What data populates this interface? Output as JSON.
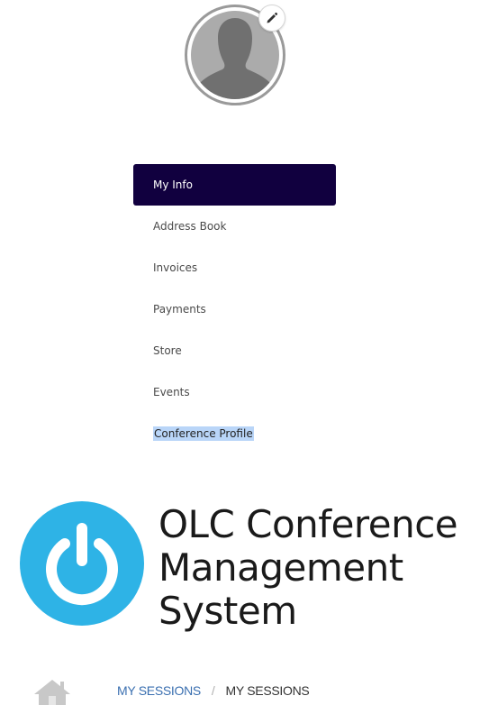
{
  "profile": {
    "avatar_icon": "user-silhouette-icon",
    "edit_icon": "pencil-icon"
  },
  "menu": {
    "items": [
      {
        "label": "My Info",
        "active": true
      },
      {
        "label": "Address Book",
        "active": false
      },
      {
        "label": "Invoices",
        "active": false
      },
      {
        "label": "Payments",
        "active": false
      },
      {
        "label": "Store",
        "active": false
      },
      {
        "label": "Events",
        "active": false
      },
      {
        "label": "Conference Profile",
        "active": false,
        "highlighted": true
      }
    ]
  },
  "logo": {
    "line1": "OLC Conference",
    "line2": "Management",
    "line3": "System",
    "icon": "power-icon"
  },
  "breadcrumb": {
    "home_icon": "home-icon",
    "link": "MY SESSIONS",
    "separator": "/",
    "current": "MY SESSIONS"
  },
  "colors": {
    "menu_active_bg": "#11003f",
    "menu_text": "#4a4a4a",
    "selection_highlight": "#b9d5f8",
    "logo_circle": "#2eb3e6",
    "breadcrumb_link": "#3a6fb0",
    "avatar_gray": "#ababab"
  }
}
